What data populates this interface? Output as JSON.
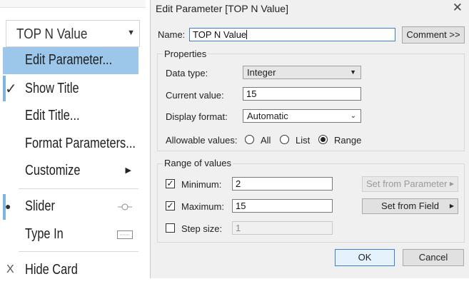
{
  "param_card": {
    "name": "TOP N Value"
  },
  "menu": {
    "edit_parameter": "Edit Parameter...",
    "show_title": "Show Title",
    "edit_title": "Edit Title...",
    "format_parameters": "Format Parameters...",
    "customize": "Customize",
    "slider": "Slider",
    "type_in": "Type In",
    "hide_card": "Hide Card",
    "check_glyph": "✓",
    "bullet_glyph": "●",
    "x_glyph": "X"
  },
  "dialog": {
    "title": "Edit Parameter [TOP N Value]",
    "name_label": "Name:",
    "name_value": "TOP N Value",
    "comment_button": "Comment >>",
    "properties_label": "Properties",
    "data_type_label": "Data type:",
    "data_type_value": "Integer",
    "current_value_label": "Current value:",
    "current_value": "15",
    "display_format_label": "Display format:",
    "display_format_value": "Automatic",
    "allowable_label": "Allowable values:",
    "allowable_options": {
      "all": "All",
      "list": "List",
      "range": "Range"
    },
    "allowable_selected": "Range",
    "range_label": "Range of values",
    "minimum_label": "Minimum:",
    "minimum_value": "2",
    "maximum_label": "Maximum:",
    "maximum_value": "15",
    "step_label": "Step size:",
    "step_value": "1",
    "set_from_parameter": "Set from Parameter",
    "set_from_field": "Set from Field",
    "ok": "OK",
    "cancel": "Cancel"
  },
  "colors": {
    "highlight": "#9cc7ea",
    "focus_border": "#3c7fd1",
    "dialog_bg": "#f0f0f0"
  }
}
